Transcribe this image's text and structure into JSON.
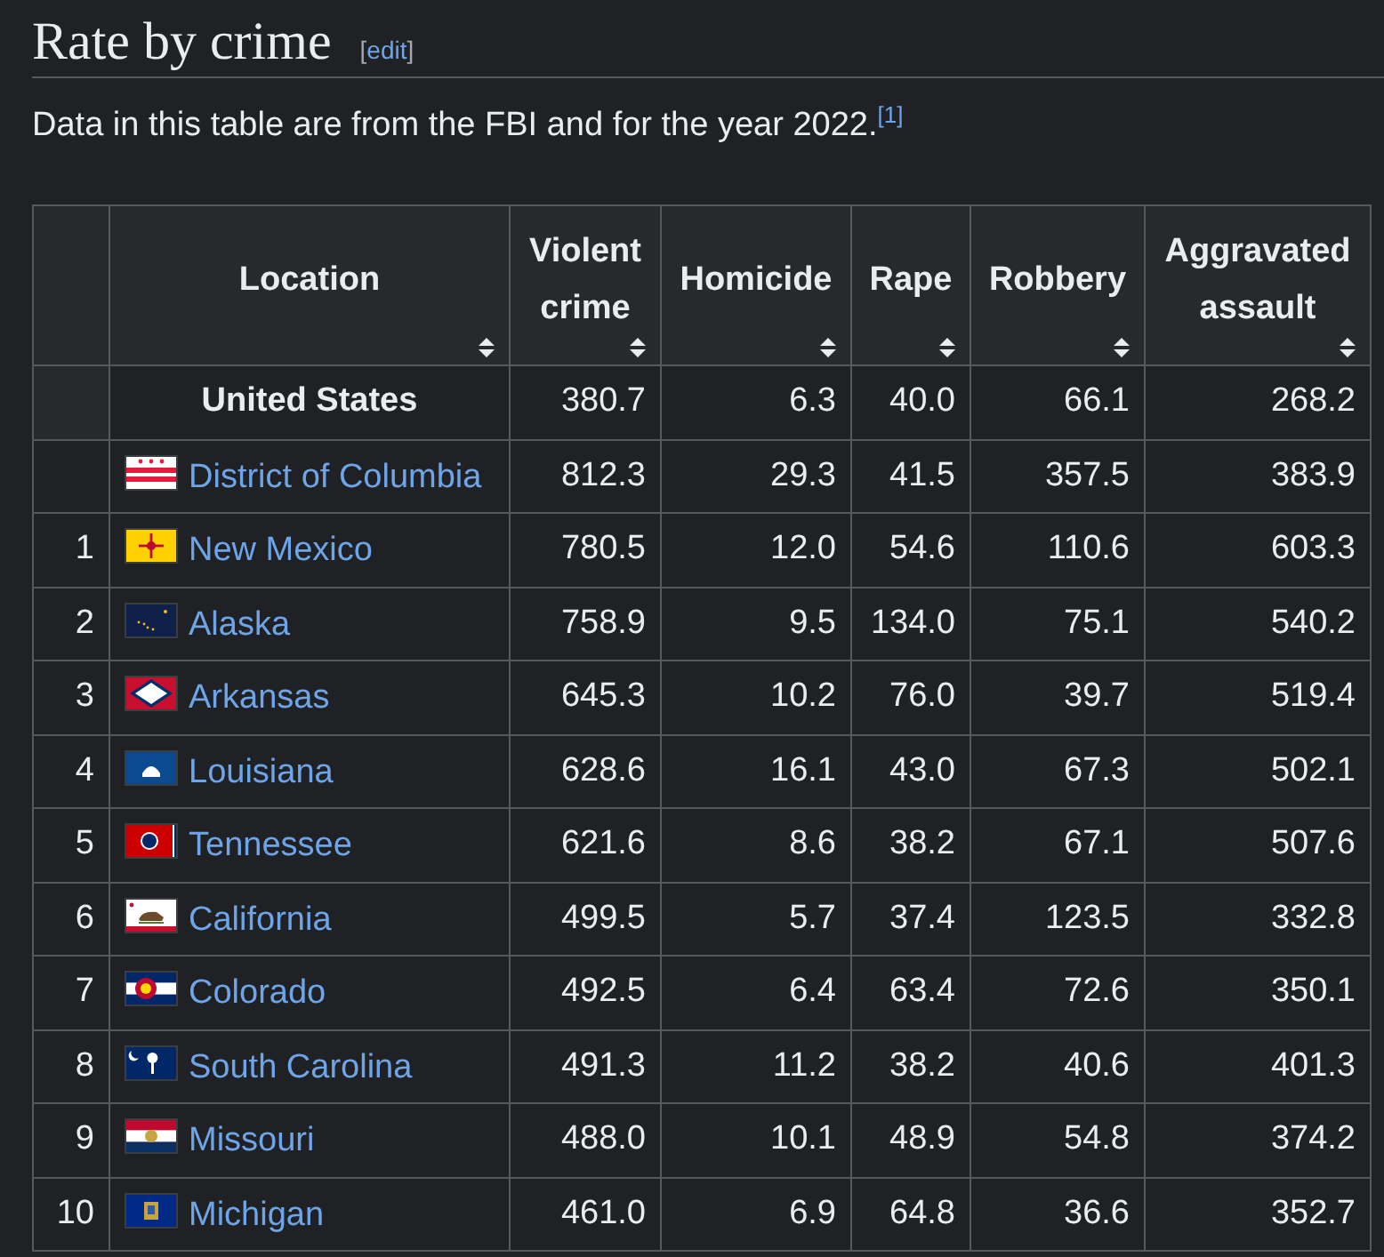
{
  "heading": {
    "title": "Rate by crime",
    "edit_link": "edit",
    "bracket_open": "[",
    "bracket_close": "]"
  },
  "intro": {
    "text": "Data in this table are from the FBI and for the year 2022.",
    "footnote": "[1]"
  },
  "table": {
    "columns": [
      {
        "label": "Location"
      },
      {
        "label": "Violent crime"
      },
      {
        "label": "Homicide"
      },
      {
        "label": "Rape"
      },
      {
        "label": "Robbery"
      },
      {
        "label": "Aggravated assault"
      }
    ],
    "rows": [
      {
        "kind": "total",
        "rank": "",
        "location": "United States",
        "values": [
          "380.7",
          "6.3",
          "40.0",
          "66.1",
          "268.2"
        ]
      },
      {
        "kind": "state",
        "rank": "",
        "location": "District of Columbia",
        "values": [
          "812.3",
          "29.3",
          "41.5",
          "357.5",
          "383.9"
        ]
      },
      {
        "kind": "state",
        "rank": "1",
        "location": "New Mexico",
        "values": [
          "780.5",
          "12.0",
          "54.6",
          "110.6",
          "603.3"
        ]
      },
      {
        "kind": "state",
        "rank": "2",
        "location": "Alaska",
        "values": [
          "758.9",
          "9.5",
          "134.0",
          "75.1",
          "540.2"
        ]
      },
      {
        "kind": "state",
        "rank": "3",
        "location": "Arkansas",
        "values": [
          "645.3",
          "10.2",
          "76.0",
          "39.7",
          "519.4"
        ]
      },
      {
        "kind": "state",
        "rank": "4",
        "location": "Louisiana",
        "values": [
          "628.6",
          "16.1",
          "43.0",
          "67.3",
          "502.1"
        ]
      },
      {
        "kind": "state",
        "rank": "5",
        "location": "Tennessee",
        "values": [
          "621.6",
          "8.6",
          "38.2",
          "67.1",
          "507.6"
        ]
      },
      {
        "kind": "state",
        "rank": "6",
        "location": "California",
        "values": [
          "499.5",
          "5.7",
          "37.4",
          "123.5",
          "332.8"
        ]
      },
      {
        "kind": "state",
        "rank": "7",
        "location": "Colorado",
        "values": [
          "492.5",
          "6.4",
          "63.4",
          "72.6",
          "350.1"
        ]
      },
      {
        "kind": "state",
        "rank": "8",
        "location": "South Carolina",
        "values": [
          "491.3",
          "11.2",
          "38.2",
          "40.6",
          "401.3"
        ]
      },
      {
        "kind": "state",
        "rank": "9",
        "location": "Missouri",
        "values": [
          "488.0",
          "10.1",
          "48.9",
          "54.8",
          "374.2"
        ]
      },
      {
        "kind": "state",
        "rank": "10",
        "location": "Michigan",
        "values": [
          "461.0",
          "6.9",
          "64.8",
          "36.6",
          "352.7"
        ]
      }
    ]
  }
}
